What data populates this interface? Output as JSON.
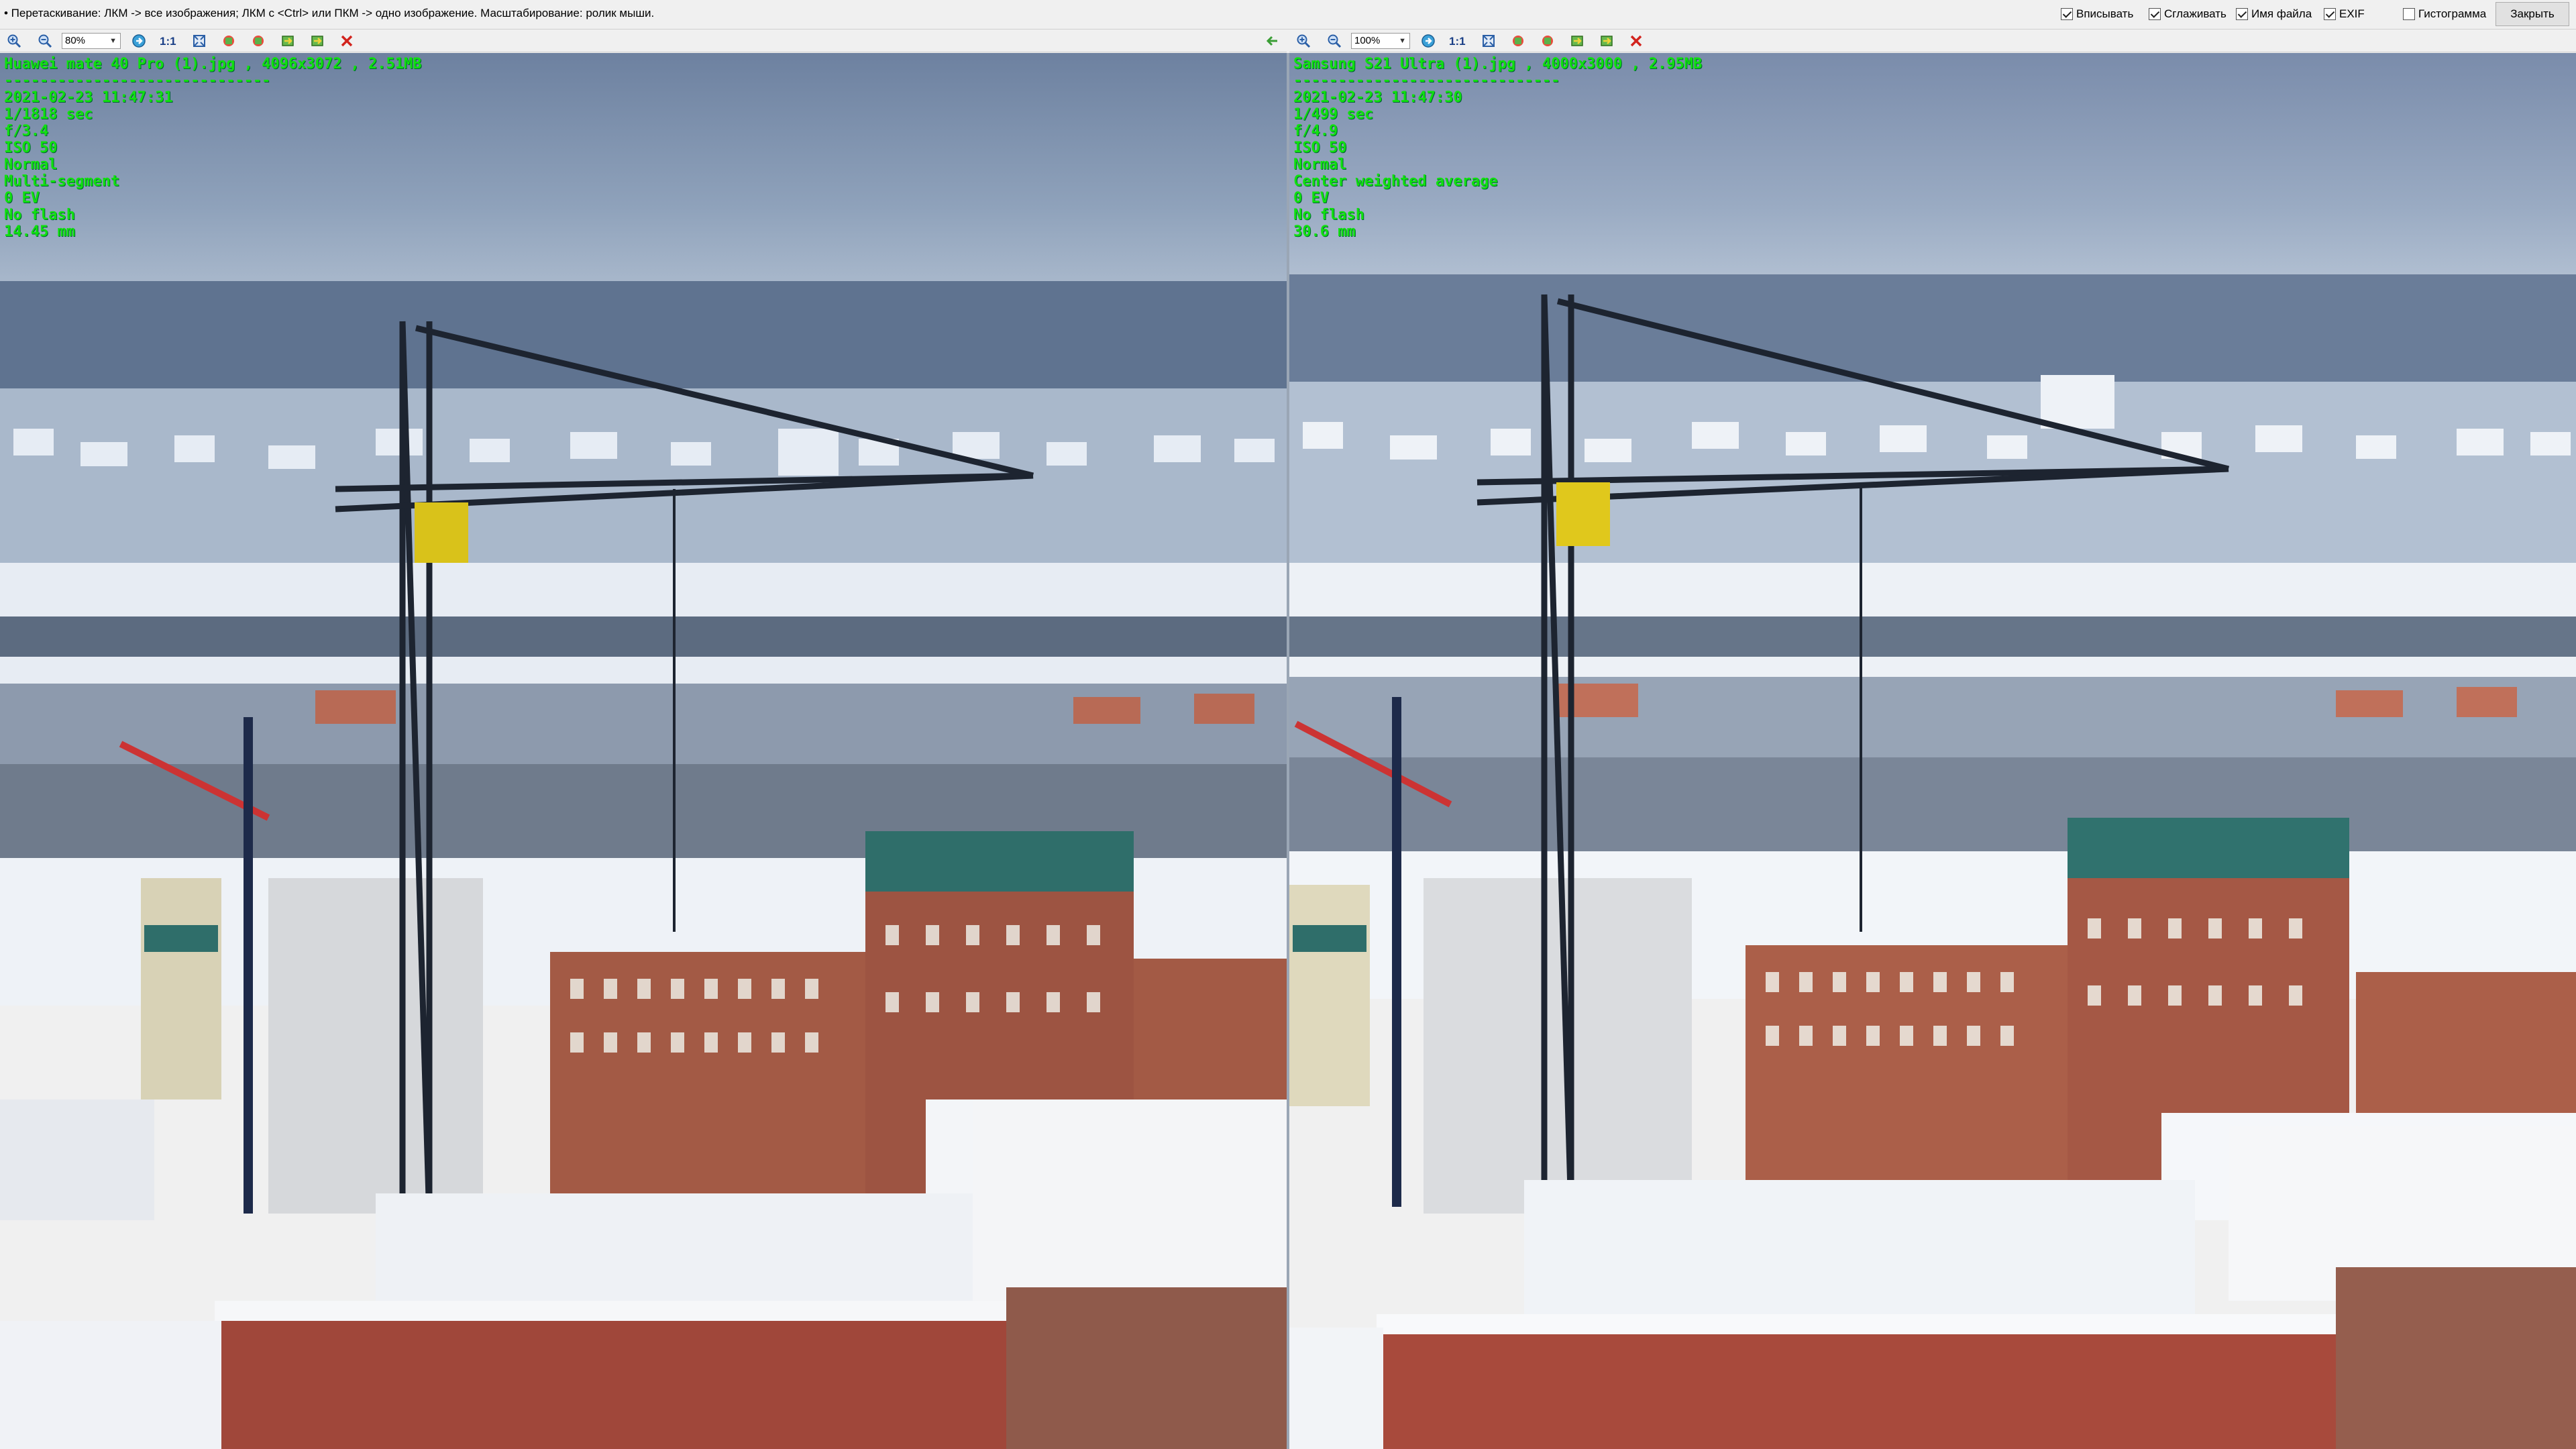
{
  "topbar": {
    "hint": "• Перетаскивание: ЛКМ -> все изображения; ЛКМ с <Ctrl> или ПКМ -> одно изображение. Масштабирование: ролик мыши.",
    "options": [
      {
        "label": "Вписывать",
        "checked": true
      },
      {
        "label": "Сглаживать",
        "checked": true
      },
      {
        "label": "Имя файла",
        "checked": true
      },
      {
        "label": "EXIF",
        "checked": true
      },
      {
        "label": "Гистограмма",
        "checked": false
      }
    ],
    "close_label": "Закрыть"
  },
  "left": {
    "zoom": "80%",
    "one_to_one": "1:1",
    "filename_line": "Huawei mate 40 Pro (1).jpg , 4096x3072 , 2.51MB",
    "separator": "------------------------------",
    "exif": [
      "2021-02-23 11:47:31",
      "1/1818 sec",
      "f/3.4",
      "ISO 50",
      "Normal",
      "Multi-segment",
      "0 EV",
      "No flash",
      "14.45 mm"
    ]
  },
  "right": {
    "zoom": "100%",
    "one_to_one": "1:1",
    "filename_line": "Samsung S21 Ultra (1).jpg , 4000x3000 , 2.95MB",
    "separator": "------------------------------",
    "exif": [
      "2021-02-23 11:47:30",
      "1/499 sec",
      "f/4.9",
      "ISO 50",
      "Normal",
      "Center weighted average",
      "0 EV",
      "No flash",
      "30.6 mm"
    ]
  },
  "icons": {
    "zoom_in": "zoom-in-icon",
    "zoom_out": "zoom-out-icon",
    "sync": "sync-arrow-icon",
    "fit": "fit-window-icon",
    "close_image": "close-icon"
  },
  "colors": {
    "exif_text": "#10e010",
    "sky": "#7e92ad",
    "snow": "#eef2f7",
    "brick": "#a35a45",
    "roof_teal": "#2f6e6a",
    "crane": "#1d2430",
    "crane_cab": "#d9c21a"
  }
}
